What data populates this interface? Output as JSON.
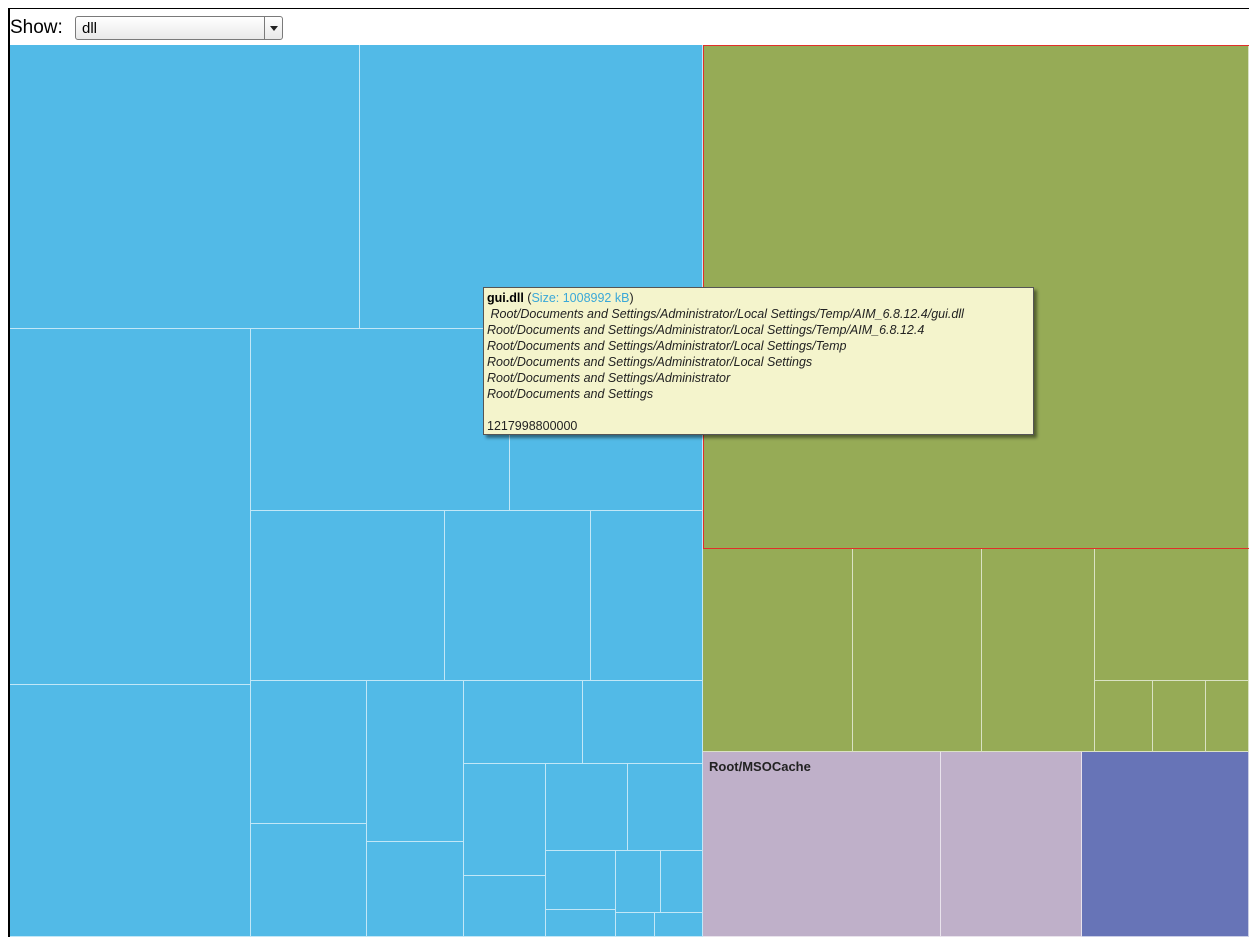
{
  "toolbar": {
    "show_label": "Show:",
    "filter_value": "dll"
  },
  "colors": {
    "blue_group": "#52bae7",
    "green_group": "#96ab56",
    "lavender_group": "#bfb0c9",
    "indigo_group": "#6774b7",
    "highlight_border": "#e0302a",
    "tooltip_background": "#f4f4cc"
  },
  "treemap": {
    "group_label": "Root/MSOCache"
  },
  "tooltip": {
    "file_name": "gui.dll",
    "open_paren": " (",
    "size_text": "Size: 1008992 kB",
    "close_paren": ")",
    "paths": [
      " Root/Documents and Settings/Administrator/Local Settings/Temp/AIM_6.8.12.4/gui.dll",
      "Root/Documents and Settings/Administrator/Local Settings/Temp/AIM_6.8.12.4",
      "Root/Documents and Settings/Administrator/Local Settings/Temp",
      "Root/Documents and Settings/Administrator/Local Settings",
      "Root/Documents and Settings/Administrator",
      "Root/Documents and Settings"
    ],
    "timestamp": "1217998800000"
  }
}
